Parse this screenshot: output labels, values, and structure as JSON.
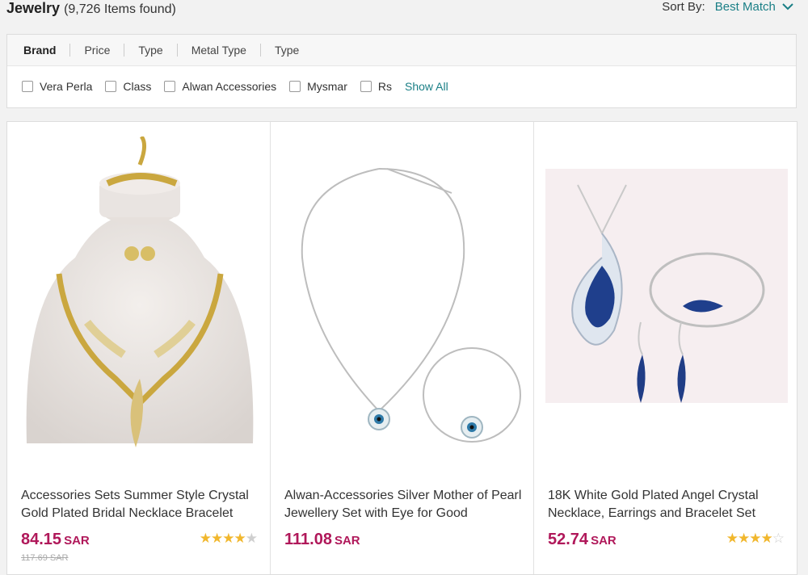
{
  "header": {
    "category": "Jewelry",
    "count_text": "(9,726 Items found)",
    "sort_label": "Sort By:",
    "sort_value": "Best Match"
  },
  "filter_tabs": [
    "Brand",
    "Price",
    "Type",
    "Metal Type",
    "Type"
  ],
  "brands": [
    "Vera Perla",
    "Class",
    "Alwan Accessories",
    "Mysmar",
    "Rs"
  ],
  "show_all": "Show All",
  "products": [
    {
      "title": "Accessories Sets Summer Style Crystal Gold Plated Bridal Necklace Bracelet",
      "price": "84.15",
      "currency": "SAR",
      "old_price": "117.69 SAR",
      "rating": 4.5
    },
    {
      "title": "Alwan-Accessories Silver Mother of Pearl Jewellery Set with Eye for Good",
      "price": "111.08",
      "currency": "SAR",
      "rating": 0
    },
    {
      "title": "18K White Gold Plated Angel Crystal Necklace, Earrings and Bracelet Set",
      "price": "52.74",
      "currency": "SAR",
      "rating": 4
    }
  ],
  "colors": {
    "accent": "#1a7f86",
    "price": "#b0185a",
    "star": "#f1b72d"
  }
}
